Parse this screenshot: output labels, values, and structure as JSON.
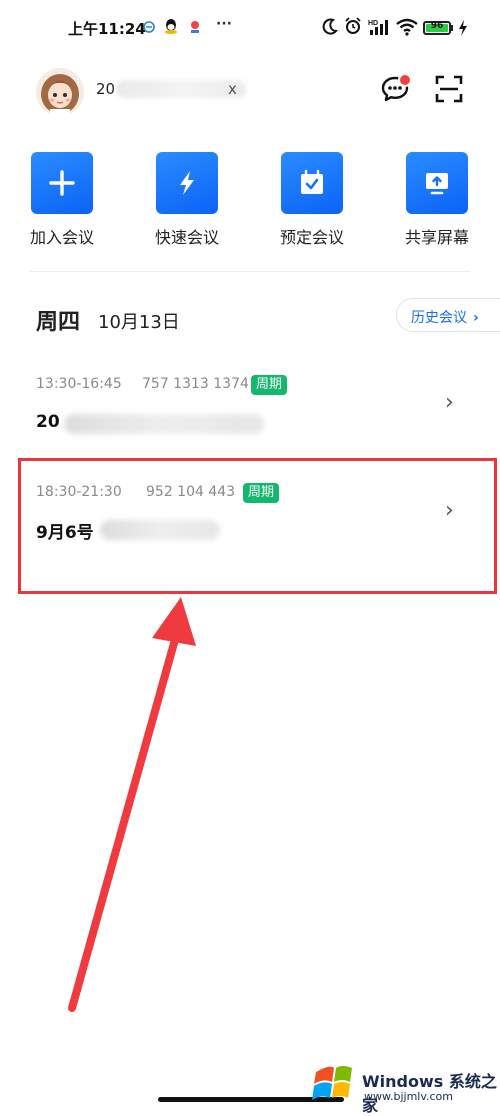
{
  "status_bar": {
    "time": "上午11:24",
    "more": "···",
    "battery": "96",
    "battery_level": 0.96
  },
  "header": {
    "username_visible": "20",
    "username_tail": "x"
  },
  "actions": [
    {
      "label": "加入会议",
      "icon": "plus-icon"
    },
    {
      "label": "快速会议",
      "icon": "lightning-icon"
    },
    {
      "label": "预定会议",
      "icon": "calendar-check-icon"
    },
    {
      "label": "共享屏幕",
      "icon": "screen-share-icon"
    }
  ],
  "date_row": {
    "weekday": "周四",
    "date": "10月13日",
    "history_button": "历史会议"
  },
  "meetings": [
    {
      "time": "13:30-16:45",
      "meeting_id": "757 1313 1374",
      "badge": "周期",
      "title_visible": "20"
    },
    {
      "time": "18:30-21:30",
      "meeting_id": "952 104 443",
      "badge": "周期",
      "title_visible": "9月6号"
    }
  ],
  "watermark": {
    "title": "Windows",
    "title_cn": "系统之家",
    "url": "www.bjjmlv.com"
  },
  "colors": {
    "accent": "#1a6cf0",
    "badge_green": "#12b86c",
    "highlight_red": "#e8363a"
  }
}
